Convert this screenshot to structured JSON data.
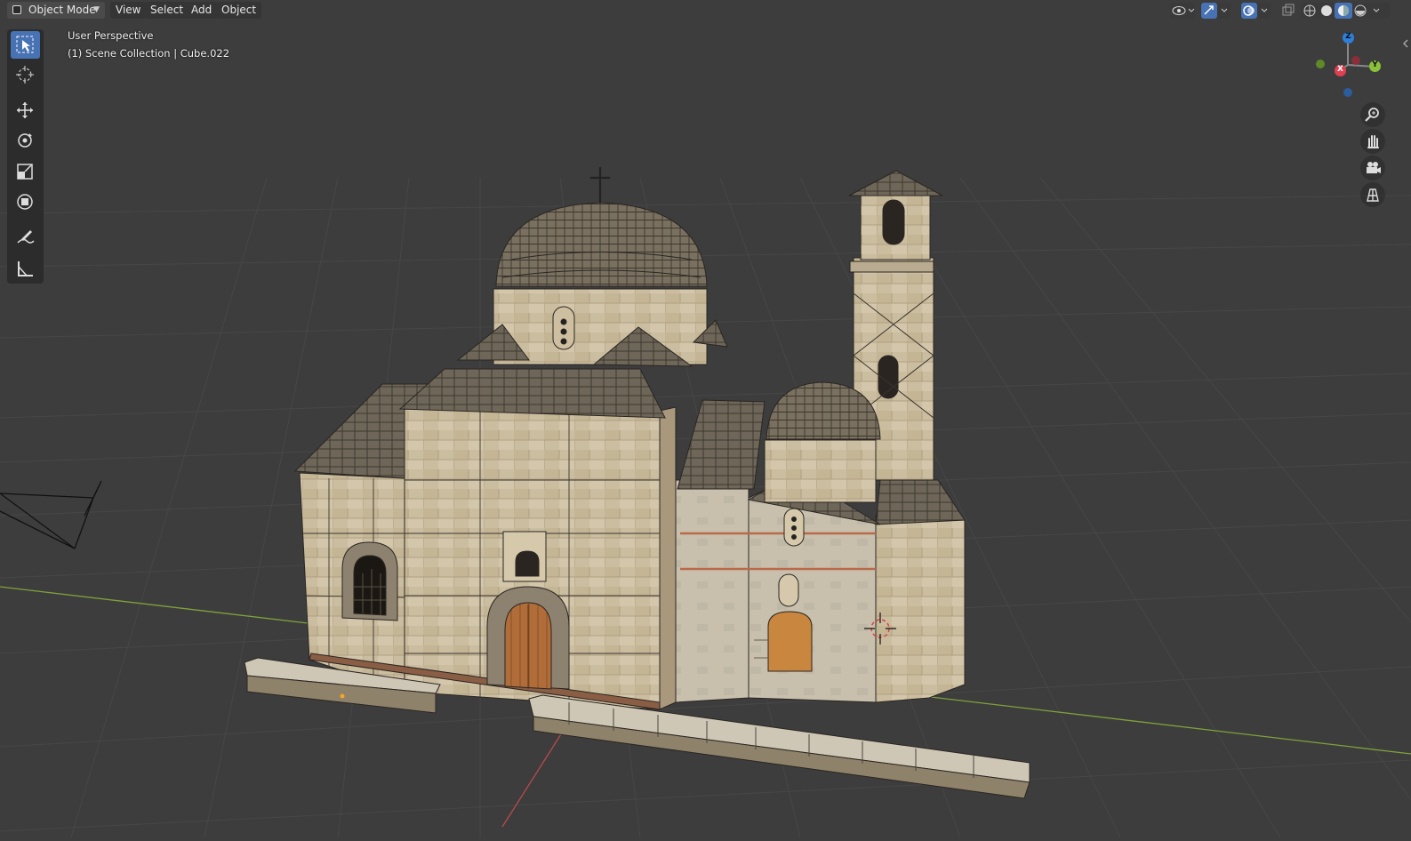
{
  "header": {
    "mode_label": "Object Mode",
    "menus": [
      "View",
      "Select",
      "Add",
      "Object"
    ]
  },
  "overlay": {
    "view_name": "User Perspective",
    "collection_info": "(1) Scene Collection | Cube.022"
  },
  "toolbar": {
    "tools": [
      "select-box-icon",
      "cursor-icon",
      "move-icon",
      "rotate-icon",
      "scale-icon",
      "transform-icon",
      "annotate-icon",
      "measure-icon"
    ],
    "active": "select-box-icon"
  },
  "gizmo": {
    "x_label": "X",
    "y_label": "Y",
    "z_label": "Z"
  },
  "colors": {
    "background": "#3d3d3d",
    "grid": "#474747",
    "x_axis": "#b84a4a",
    "y_axis": "#7fa23a",
    "active_tool": "#4772b3"
  },
  "scene": {
    "object": "church model",
    "viewport_shading": "material-preview"
  }
}
